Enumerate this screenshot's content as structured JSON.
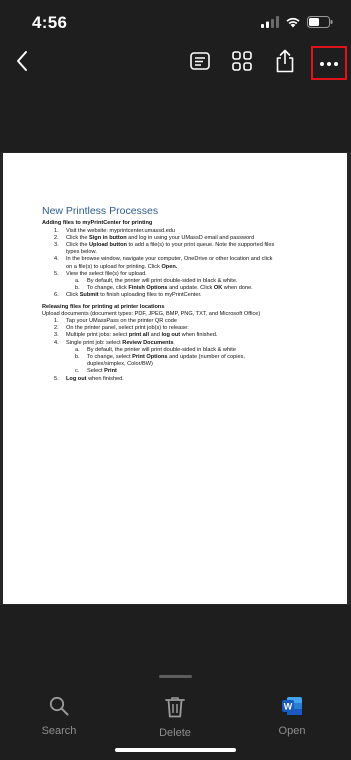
{
  "status_bar": {
    "time": "4:56"
  },
  "toolbar": {
    "back_icon": "chevron-left-icon",
    "actions": [
      "notes-icon",
      "grid-icon",
      "share-icon",
      "more-icon"
    ],
    "highlight_color": "#e0151b"
  },
  "document": {
    "title": "New Printless Processes",
    "section1": {
      "heading": "Adding files to myPrintCenter for printing",
      "lines": [
        {
          "n": "1.",
          "parts": [
            {
              "t": "Visit the website: myprintcenter.umassd.edu",
              "b": false
            }
          ]
        },
        {
          "n": "2.",
          "parts": [
            {
              "t": "Click the ",
              "b": false
            },
            {
              "t": "Sign in button",
              "b": true
            },
            {
              "t": " and log in using your UMassD email and password",
              "b": false
            }
          ]
        },
        {
          "n": "3.",
          "parts": [
            {
              "t": "Click the ",
              "b": false
            },
            {
              "t": "Upload button",
              "b": true
            },
            {
              "t": " to add a file(s) to your print queue. Note the supported files",
              "b": false
            }
          ]
        },
        {
          "n": "",
          "parts": [
            {
              "t": "types below.",
              "b": false
            }
          ]
        },
        {
          "n": "4.",
          "parts": [
            {
              "t": "In the browse window, navigate your computer, OneDrive or other location and click",
              "b": false
            }
          ]
        },
        {
          "n": "",
          "parts": [
            {
              "t": "on a file(s) to upload for printing. Click ",
              "b": false
            },
            {
              "t": "Open.",
              "b": true
            }
          ]
        },
        {
          "n": "5.",
          "parts": [
            {
              "t": "View the select file(s) for upload.",
              "b": false
            }
          ]
        },
        {
          "n": "a.",
          "sub": true,
          "parts": [
            {
              "t": "By default, the printer will print double-sided in black & white.",
              "b": false
            }
          ]
        },
        {
          "n": "b.",
          "sub": true,
          "parts": [
            {
              "t": "To change, click ",
              "b": false
            },
            {
              "t": "Finish Options",
              "b": true
            },
            {
              "t": " and update. Click ",
              "b": false
            },
            {
              "t": "OK",
              "b": true
            },
            {
              "t": " when done.",
              "b": false
            }
          ]
        },
        {
          "n": "6.",
          "parts": [
            {
              "t": "Click ",
              "b": false
            },
            {
              "t": "Submit",
              "b": true
            },
            {
              "t": " to finish uploading files to myPrintCenter.",
              "b": false
            }
          ]
        }
      ]
    },
    "section2": {
      "heading": "Releasing files for printing at printer locations",
      "intro": "Upload documents (document types: PDF, JPEG, BMP, PNG, TXT, and Microsoft Office)",
      "lines": [
        {
          "n": "1.",
          "parts": [
            {
              "t": "Tap your UMassPass on the printer QR code",
              "b": false
            }
          ]
        },
        {
          "n": "2.",
          "parts": [
            {
              "t": "On the printer panel, select print job(s) to release:",
              "b": false
            }
          ]
        },
        {
          "n": "3.",
          "parts": [
            {
              "t": "Multiple print jobs: select ",
              "b": false
            },
            {
              "t": "print all",
              "b": true
            },
            {
              "t": " and ",
              "b": false
            },
            {
              "t": "log out",
              "b": true
            },
            {
              "t": " when finished.",
              "b": false
            }
          ]
        },
        {
          "n": "4.",
          "parts": [
            {
              "t": "Single print job: select ",
              "b": false
            },
            {
              "t": "Review Documents",
              "b": true
            }
          ]
        },
        {
          "n": "a.",
          "sub": true,
          "parts": [
            {
              "t": "By default, the printer will print double-sided in black & white",
              "b": false
            }
          ]
        },
        {
          "n": "b.",
          "sub": true,
          "parts": [
            {
              "t": "To change, select ",
              "b": false
            },
            {
              "t": "Print Options",
              "b": true
            },
            {
              "t": " and update (number of copies,",
              "b": false
            }
          ]
        },
        {
          "n": "",
          "sub": true,
          "parts": [
            {
              "t": "duplex/simplex, Color/BW)",
              "b": false
            }
          ]
        },
        {
          "n": "c.",
          "sub": true,
          "parts": [
            {
              "t": "Select ",
              "b": false
            },
            {
              "t": "Print",
              "b": true
            }
          ]
        },
        {
          "n": "5.",
          "parts": [
            {
              "t": "Log out",
              "b": true
            },
            {
              "t": " when finished.",
              "b": false
            }
          ]
        }
      ]
    }
  },
  "bottom_nav": {
    "search_label": "Search",
    "delete_label": "Delete",
    "open_label": "Open",
    "word_badge": "W",
    "word_color": "#185abd"
  }
}
